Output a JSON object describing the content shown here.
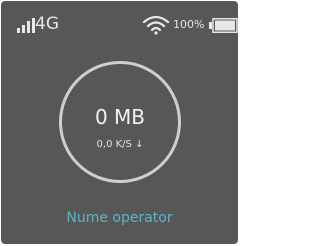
{
  "status_bar": {
    "network_type": "4G",
    "signal_icon": "signal-bars-icon",
    "wifi_icon": "wifi-icon",
    "battery_percent": "100%",
    "battery_icon": "battery-icon",
    "battery_level": 1.0
  },
  "usage": {
    "data_used": "0 MB",
    "speed": "0,0 K/S",
    "speed_arrow": "↓"
  },
  "operator": {
    "name": "Nume operator"
  },
  "colors": {
    "background": "#575757",
    "text": "#e6e6e6",
    "ring": "#cfcfcf",
    "operator_accent": "#58b7c4"
  }
}
